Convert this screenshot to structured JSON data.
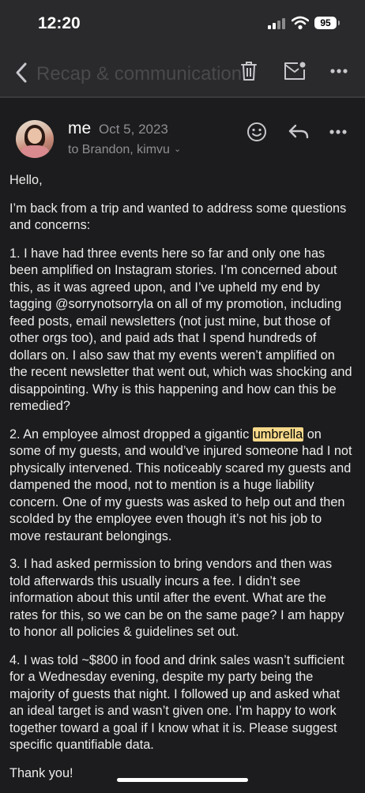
{
  "status_bar": {
    "time": "12:20",
    "battery": "95"
  },
  "nav": {
    "title": "Recap & communication"
  },
  "message": {
    "sender": "me",
    "date": "Oct 5, 2023",
    "recipients": "to Brandon, kimvu",
    "greeting": "Hello,",
    "intro": "I’m back from a trip and wanted to address some questions and concerns:",
    "point1": "1. I have had three events here so far and only one has been amplified on Instagram stories. I’m concerned about this, as it was agreed upon, and I’ve upheld my end by tagging @sorrynotsorryla on all of my promotion, including feed posts, email newsletters (not just mine, but those of other orgs too), and paid ads that I spend hundreds of dollars on. I also saw that my events weren’t amplified on the recent newsletter that went out, which was shocking and disappointing. Why is this happening and how can this be remedied?",
    "point2_before": "2. An employee almost dropped a gigantic ",
    "point2_highlight": "umbrella",
    "point2_after": " on some of my guests, and would’ve injured someone had I not physically intervened. This noticeably scared my guests and dampened the mood, not to mention is a huge liability concern. One of my guests was asked to help out and then scolded by the employee even though it’s not his job to move restaurant belongings.",
    "point3": "3. I had asked permission to bring vendors and then was told afterwards this usually incurs a fee. I didn’t see information about this until after the event. What are the rates for this, so we can be on the same page? I am happy to honor all policies & guidelines set out.",
    "point4": "4. I was told ~$800 in food and drink sales wasn’t sufficient for a Wednesday evening, despite my party being the majority of guests that night. I followed up and asked what an ideal target is and wasn’t given one. I’m happy to work together toward a goal if I know what it is. Please suggest specific quantifiable data.",
    "closing": "Thank you!"
  },
  "icons": {
    "back": "chevron-left-icon",
    "trash": "trash-icon",
    "mail": "mail-unread-icon",
    "more": "ellipsis-icon",
    "emoji": "smiley-icon",
    "reply": "reply-icon"
  },
  "colors": {
    "background": "#1c1c1e",
    "highlight": "#f5d88a",
    "secondary_text": "#8e8e93"
  }
}
